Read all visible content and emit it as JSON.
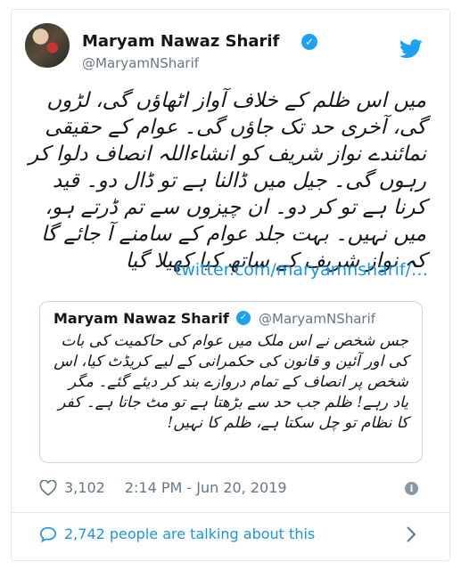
{
  "tweet": {
    "author_name": "Maryam Nawaz Sharif",
    "handle": "@MaryamNSharif",
    "text": "میں اس ظلم کے خلاف آواز اٹھاؤں گی، لڑوں گی، آخری حد تک جاؤں گی۔ عوام کے حقیقی نمائندے نواز شریف کو انشاءاللہ انصاف دلوا کر رہوں گی۔ جیل میں ڈالنا ہے تو ڈال دو۔ قید کرنا ہے تو کر دو۔ ان چیزوں سے تم ڈرتے ہو، میں نہیں۔ بہت جلد عوام کے سامنے آ جائے گا کہ نواز شریف کے ساتھ کیا کھیلا گیا",
    "link": "twitter.com/maryamnsharif/…"
  },
  "quoted_tweet": {
    "author_name": "Maryam Nawaz Sharif",
    "handle": "@MaryamNSharif",
    "text": "جس شخص نے اس ملک میں عوام کی حاکمیت کی بات کی اور آئین و قانون کی حکمرانی کے لیے کریڈٹ کیا، اس شخص پر انصاف کے تمام دروازے بند کر دیئے گئے۔ مگر یاد رہے! ظلم جب حد سے بڑھتا ہے تو مٹ جاتا ہے۔ کفر کا نظام تو چل سکتا ہے، ظلم کا نہیں!"
  },
  "footer": {
    "likes": "3,102",
    "timestamp": "2:14 PM - Jun 20, 2019",
    "talking": "2,742 people are talking about this"
  },
  "colors": {
    "twitter_blue": "#1da1f2",
    "link_blue": "#1b95e0",
    "muted": "#657786"
  },
  "icons": [
    "avatar",
    "verified-badge-icon",
    "twitter-bird-icon",
    "heart-icon",
    "info-icon",
    "speech-bubble-icon",
    "chevron-right-icon"
  ]
}
